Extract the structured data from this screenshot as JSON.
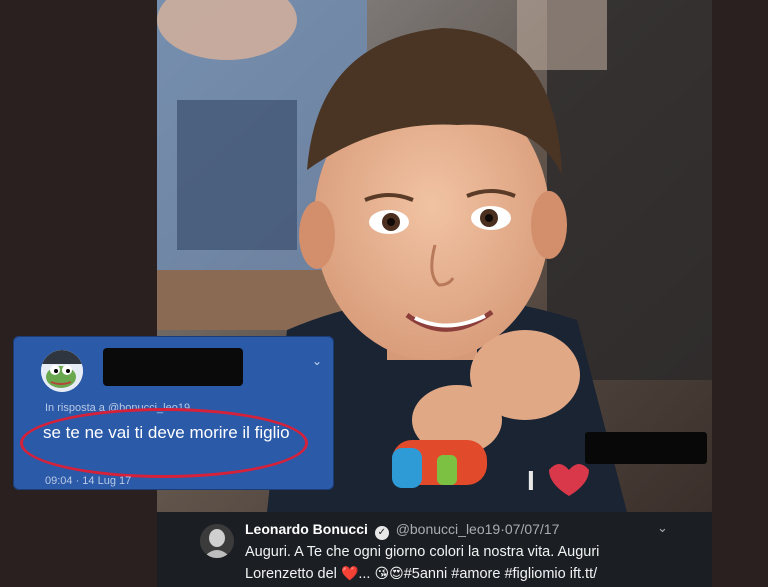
{
  "photo": {
    "description_icon": "child-portrait-photo"
  },
  "reply_tweet": {
    "reply_to": "In risposta a @bonucci_leo19",
    "text": "se te ne vai ti deve morire il figlio",
    "time": "09:04 · 14 Lug 17",
    "caret": "⌄"
  },
  "tweet": {
    "name": "Leonardo Bonucci",
    "verified_glyph": "✓",
    "handle": "@bonucci_leo19",
    "separator": "·",
    "date": "07/07/17",
    "caret": "⌄",
    "text_line1": "Auguri. A Te che ogni giorno colori la nostra vita. Auguri",
    "text_line2_prefix": "Lorenzetto del",
    "heart": "❤️",
    "ellipsis": "...",
    "emojis": "😘😍",
    "hashtags": "#5anni #amore #figliomio ift.tt/"
  },
  "colors": {
    "background": "#2a2020",
    "tweet_bg": "#1b1f24",
    "reply_bg": "#2a5aa8",
    "oval": "#d6213b"
  }
}
